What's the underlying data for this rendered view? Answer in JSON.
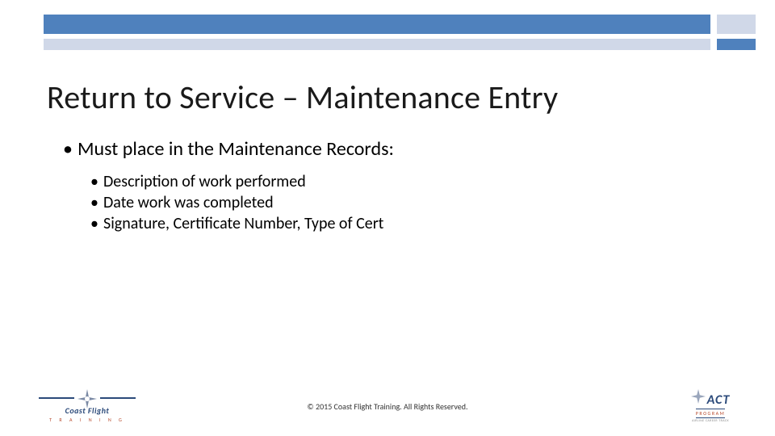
{
  "title": "Return to Service – Maintenance Entry",
  "bullets": {
    "lvl1": "Must place in the Maintenance Records:",
    "lvl2": [
      "Description of work performed",
      "Date work was completed",
      "Signature, Certificate Number, Type of Cert"
    ]
  },
  "footer": {
    "copyright": "© 2015 Coast Flight Training. All Rights Reserved."
  },
  "logos": {
    "left": {
      "main": "Coast Flight",
      "sub": "T R A I N I N G"
    },
    "right": {
      "main": "ACT",
      "program": "PROGRAM",
      "sub": "AIRLINE CAREER TRACK"
    }
  },
  "colors": {
    "accent_blue": "#4f81bd",
    "accent_light": "#d0d8e8",
    "logo_navy": "#2b4a7a",
    "logo_orange": "#b84b2e"
  }
}
